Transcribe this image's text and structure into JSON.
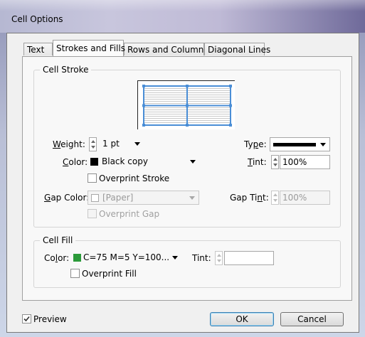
{
  "window": {
    "title": "Cell Options"
  },
  "tabs": [
    {
      "label": "Text",
      "active": false
    },
    {
      "label": "Strokes and Fills",
      "active": true
    },
    {
      "label": "Rows and Columns",
      "active": false
    },
    {
      "label": "Diagonal Lines",
      "active": false
    }
  ],
  "cell_stroke": {
    "legend": "Cell Stroke",
    "weight_label_u": "W",
    "weight_label_rest": "eight:",
    "weight_value": "1 pt",
    "type_label_pre": "Ty",
    "type_label_u": "p",
    "type_label_post": "e:",
    "color_label_pre": "",
    "color_label_u": "C",
    "color_label_post": "olor:",
    "color_value": "Black copy",
    "color_swatch": "#000000",
    "tint_label_u": "T",
    "tint_label_rest": "int:",
    "tint_value": "100%",
    "overprint_stroke": "Overprint Stroke",
    "gap_color_label_u": "G",
    "gap_color_label_rest": "ap Color:",
    "gap_color_value": "[Paper]",
    "gap_tint_label_pre": "Gap Ti",
    "gap_tint_label_u": "n",
    "gap_tint_label_post": "t:",
    "gap_tint_value": "100%",
    "overprint_gap": "Overprint Gap"
  },
  "cell_fill": {
    "legend": "Cell Fill",
    "color_label_pre": "Co",
    "color_label_u": "l",
    "color_label_post": "or:",
    "color_value": "C=75 M=5 Y=100...",
    "color_swatch": "#2b9a3a",
    "tint_label": "Tint:",
    "tint_value": "",
    "overprint_fill": "Overprint Fill"
  },
  "footer": {
    "preview_label": "Preview",
    "preview_checked": true,
    "ok_label": "OK",
    "cancel_label": "Cancel"
  },
  "colors": {
    "selection_blue": "#4a8ed6",
    "fill_green": "#2b9a3a"
  }
}
